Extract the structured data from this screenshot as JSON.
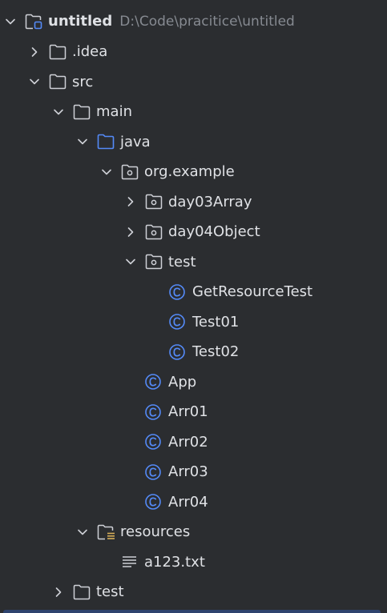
{
  "project": {
    "name": "untitled",
    "path": "D:\\Code\\pracitice\\untitled"
  },
  "nodes": {
    "idea": ".idea",
    "src": "src",
    "main": "main",
    "java": "java",
    "org_example": "org.example",
    "day03": "day03Array",
    "day04": "day04Object",
    "test_pkg": "test",
    "get_resource_test": "GetResourceTest",
    "test01": "Test01",
    "test02": "Test02",
    "app": "App",
    "arr01": "Arr01",
    "arr02": "Arr02",
    "arr03": "Arr03",
    "arr04": "Arr04",
    "resources": "resources",
    "a123": "a123.txt",
    "test_dir": "test"
  },
  "colors": {
    "background": "#2b2d30",
    "text": "#dfe1e5",
    "path_text": "#868a91",
    "icon_gray": "#ced0d6",
    "java_blue": "#548af7",
    "class_blue": "#548af7",
    "resource_yellow": "#d6ae58",
    "selection_bar": "#2e436e"
  }
}
